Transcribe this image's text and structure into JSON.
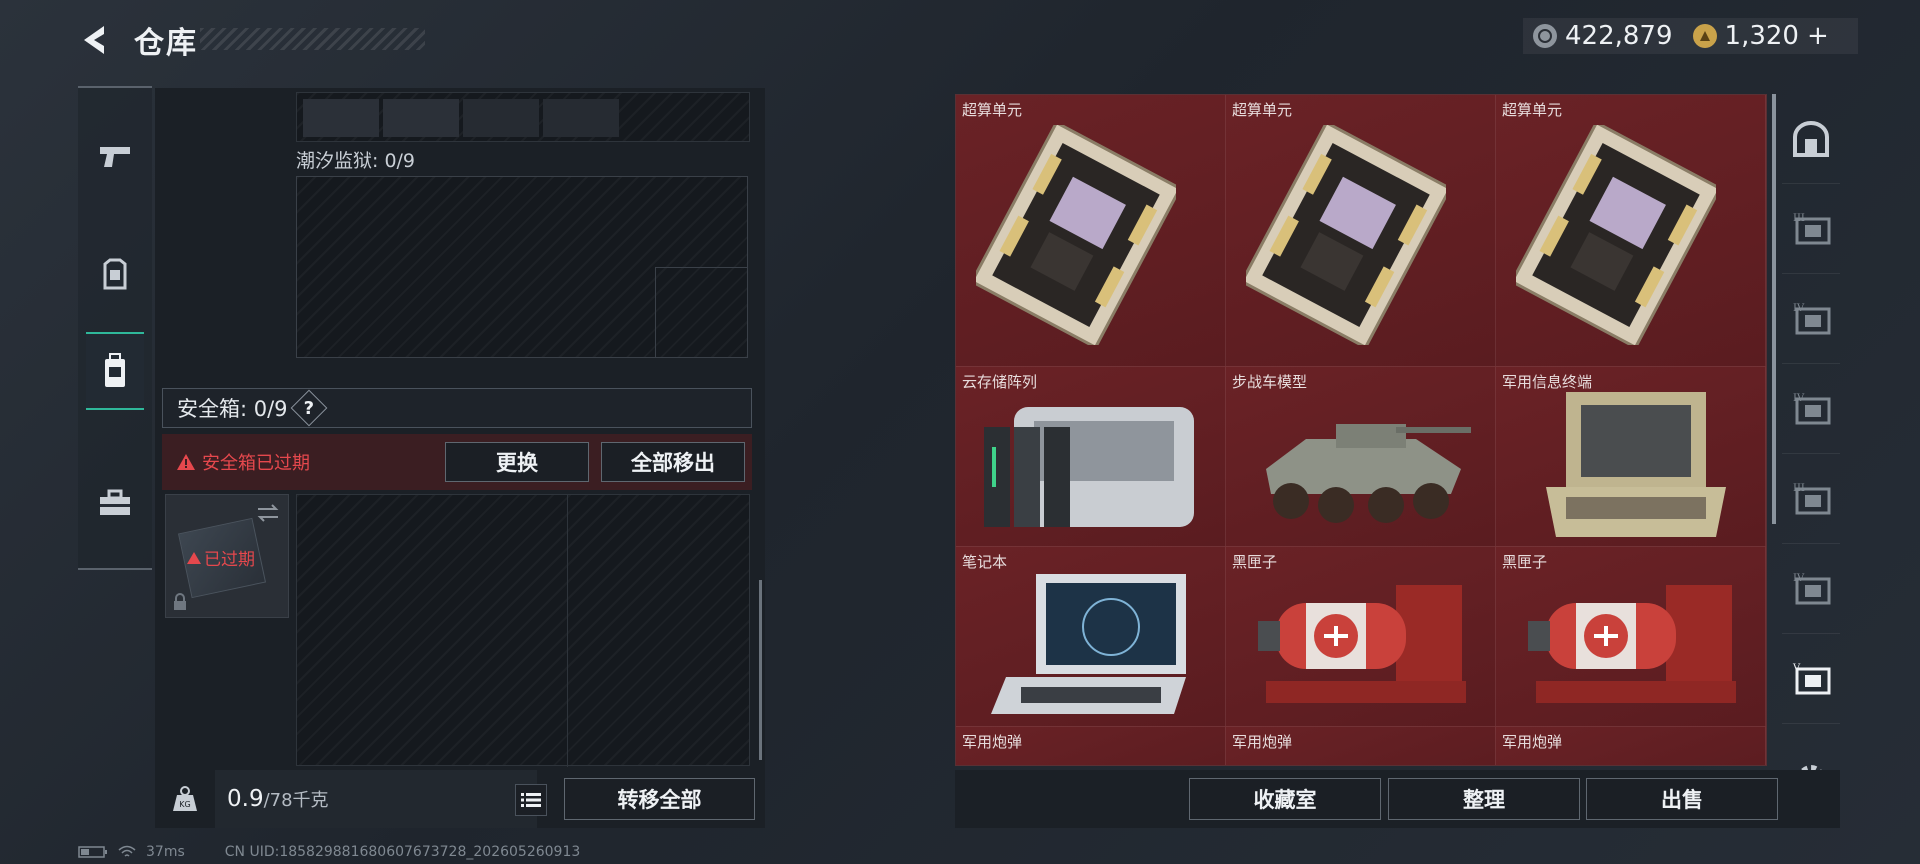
{
  "header": {
    "title": "仓库",
    "currency1": {
      "icon": "silver-coin-icon",
      "value": "422,879"
    },
    "currency2": {
      "icon": "gold-coin-icon",
      "value": "1,320"
    },
    "add_label": "+"
  },
  "left_rail": {
    "items": [
      {
        "icon": "pistol-icon",
        "active": false
      },
      {
        "icon": "armor-icon",
        "active": false
      },
      {
        "icon": "backpack-icon",
        "active": true
      },
      {
        "icon": "toolbox-icon",
        "active": false
      }
    ]
  },
  "container": {
    "tide_prison_label": "潮汐监狱: 0/9",
    "safe_box_label": "安全箱: 0/9",
    "help_label": "?",
    "expired_warning": "安全箱已过期",
    "replace_button": "更换",
    "move_all_out_button": "全部移出",
    "case_expired_label": "已过期"
  },
  "weight": {
    "current": "0.9",
    "max": "/78千克",
    "transfer_all_button": "转移全部"
  },
  "status_bar": {
    "ping": "37ms",
    "uid": "CN UID:185829881680607673728_202605260913"
  },
  "stash": {
    "items": [
      {
        "name": "超算单元",
        "icon": "circuit-board-icon"
      },
      {
        "name": "超算单元",
        "icon": "circuit-board-icon"
      },
      {
        "name": "超算单元",
        "icon": "circuit-board-icon"
      },
      {
        "name": "云存储阵列",
        "icon": "server-array-icon"
      },
      {
        "name": "步战车模型",
        "icon": "armored-vehicle-icon"
      },
      {
        "name": "军用信息终端",
        "icon": "field-terminal-icon"
      },
      {
        "name": "笔记本",
        "icon": "laptop-icon"
      },
      {
        "name": "黑匣子",
        "icon": "black-box-icon"
      },
      {
        "name": "黑匣子",
        "icon": "black-box-icon"
      },
      {
        "name": "军用炮弹",
        "icon": "shell-icon"
      },
      {
        "name": "军用炮弹",
        "icon": "shell-icon"
      },
      {
        "name": "军用炮弹",
        "icon": "shell-icon"
      }
    ],
    "collection_button": "收藏室",
    "organize_button": "整理",
    "sell_button": "出售"
  },
  "right_rail": {
    "items": [
      "vault-icon",
      "tier-3-stash-icon",
      "tier-4-stash-icon",
      "tier-4-case-icon",
      "tier-3-case-icon",
      "tier-4-box-icon",
      "tier-5-stash-icon",
      "settings-icon"
    ]
  },
  "colors": {
    "accent": "#2fb89a",
    "danger": "#e5484d",
    "item_bg": "#6a2226"
  }
}
